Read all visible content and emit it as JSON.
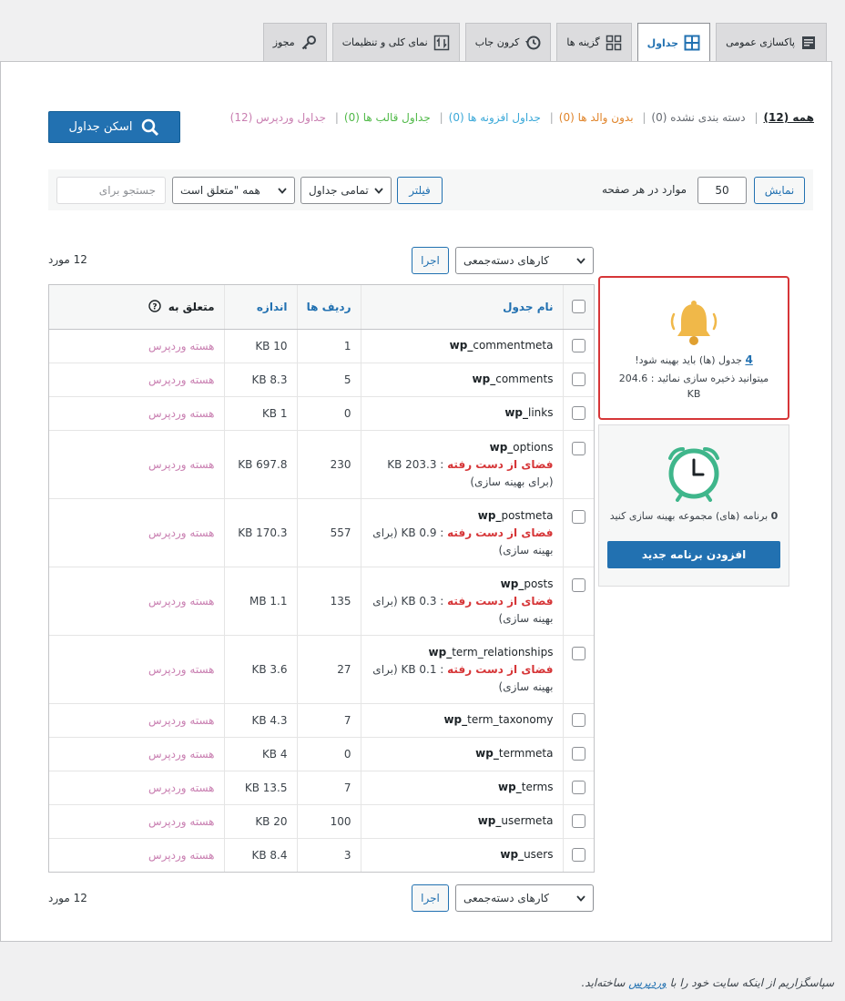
{
  "tabs": [
    {
      "label": "پاکسازی عمومی",
      "icon": "document-icon",
      "active": false
    },
    {
      "label": "جداول",
      "icon": "table-grid-icon",
      "active": true
    },
    {
      "label": "گزینه ها",
      "icon": "qr-grid-icon",
      "active": false
    },
    {
      "label": "کرون جاب",
      "icon": "clock-history-icon",
      "active": false
    },
    {
      "label": "نمای کلی و تنظیمات",
      "icon": "sort-arrows-icon",
      "active": false
    },
    {
      "label": "مجوز",
      "icon": "key-icon",
      "active": false
    }
  ],
  "filters": {
    "all": "همه (12)",
    "uncategorized": "دسته بندی نشده (0)",
    "orphans": "بدون والد ها (0)",
    "plugins": "جداول افزونه ها (0)",
    "themes": "جداول قالب ها (0)",
    "wordpress": "جداول وردپرس (12)"
  },
  "scan_button": "اسکن جداول",
  "toolbar": {
    "show_button": "نمایش",
    "per_page_value": "50",
    "per_page_label": "موارد در هر صفحه",
    "filter_button": "فیلتر",
    "select_tables": "تمامی جداول",
    "select_belongs": "همه \"متعلق است",
    "search_placeholder": "جستجو برای"
  },
  "bulk": {
    "select": "کارهای دسته‌جمعی",
    "apply": "اجرا",
    "count": "12 مورد"
  },
  "table": {
    "headers": {
      "name": "نام جدول",
      "rows": "ردیف ها",
      "size": "اندازه",
      "belongs": "متعلق به"
    },
    "lost_label": "فضای از دست رفته",
    "rows": [
      {
        "prefix": "wp_",
        "name": "commentmeta",
        "rows": "1",
        "size": "KB 10",
        "belongs": "هسته وردپرس"
      },
      {
        "prefix": "wp_",
        "name": "comments",
        "rows": "5",
        "size": "KB 8.3",
        "belongs": "هسته وردپرس"
      },
      {
        "prefix": "wp_",
        "name": "links",
        "rows": "0",
        "size": "KB 1",
        "belongs": "هسته وردپرس"
      },
      {
        "prefix": "wp_",
        "name": "options",
        "rows": "230",
        "size": "KB 697.8",
        "belongs": "هسته وردپرس",
        "lost_value": " : KB 203.3",
        "lost_note": "(برای بهینه سازی)"
      },
      {
        "prefix": "wp_",
        "name": "postmeta",
        "rows": "557",
        "size": "KB 170.3",
        "belongs": "هسته وردپرس",
        "lost_value": " : KB 0.9 (برای",
        "lost_note": "بهینه سازی)"
      },
      {
        "prefix": "wp_",
        "name": "posts",
        "rows": "135",
        "size": "MB 1.1",
        "belongs": "هسته وردپرس",
        "lost_value": " : KB 0.3 (برای",
        "lost_note": "بهینه سازی)"
      },
      {
        "prefix": "wp_",
        "name": "term_relationships",
        "rows": "27",
        "size": "KB 3.6",
        "belongs": "هسته وردپرس",
        "lost_value": " : KB 0.1 (برای",
        "lost_note": "بهینه سازی)"
      },
      {
        "prefix": "wp_",
        "name": "term_taxonomy",
        "rows": "7",
        "size": "KB 4.3",
        "belongs": "هسته وردپرس"
      },
      {
        "prefix": "wp_",
        "name": "termmeta",
        "rows": "0",
        "size": "KB 4",
        "belongs": "هسته وردپرس"
      },
      {
        "prefix": "wp_",
        "name": "terms",
        "rows": "7",
        "size": "KB 13.5",
        "belongs": "هسته وردپرس"
      },
      {
        "prefix": "wp_",
        "name": "usermeta",
        "rows": "100",
        "size": "KB 20",
        "belongs": "هسته وردپرس"
      },
      {
        "prefix": "wp_",
        "name": "users",
        "rows": "3",
        "size": "KB 8.4",
        "belongs": "هسته وردپرس"
      }
    ]
  },
  "alert": {
    "count": "4",
    "text": " جدول (ها) باید بهینه شود!",
    "saving": "میتوانید ذخیره سازی نمائید : 204.6 KB",
    "icon": "bell-icon"
  },
  "schedule": {
    "count": "0",
    "text": " برنامه (های) مجموعه بهینه سازی کنید",
    "button": "افزودن برنامه جدید",
    "icon": "alarm-clock-icon"
  },
  "footer": {
    "before": "سپاسگزاریم از اینکه سایت خود را با ",
    "link": "وردپرس",
    "after": " ساخته‌اید."
  },
  "colors": {
    "accent": "#2271b1",
    "danger": "#d63638",
    "bell": "#f0b849",
    "clock": "#3fb68b"
  }
}
